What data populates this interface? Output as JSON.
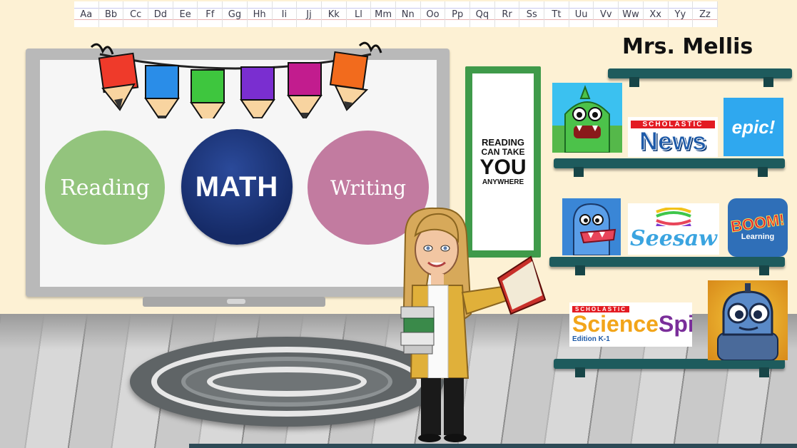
{
  "alphabet": [
    "Aa",
    "Bb",
    "Cc",
    "Dd",
    "Ee",
    "Ff",
    "Gg",
    "Hh",
    "Ii",
    "Jj",
    "Kk",
    "Ll",
    "Mm",
    "Nn",
    "Oo",
    "Pp",
    "Qq",
    "Rr",
    "Ss",
    "Tt",
    "Uu",
    "Vv",
    "Ww",
    "Xx",
    "Yy",
    "Zz"
  ],
  "teacher_name": "Mrs. Mellis",
  "subjects": {
    "reading": "Reading",
    "math": "MATH",
    "writing": "Writing"
  },
  "poster": {
    "line1": "READING",
    "line2": "CAN TAKE",
    "line3": "YOU",
    "line4": "ANYWHERE"
  },
  "apps": {
    "scholastic_news": {
      "tag": "SCHOLASTIC",
      "word": "News"
    },
    "epic": "epic!",
    "seesaw": "Seesaw",
    "boom": {
      "word": "BOOM!",
      "sub": "Learning"
    },
    "science_spin": {
      "tag": "SCHOLASTIC",
      "word_a": "Science",
      "word_b": "Spin",
      "edition": "Edition K-1"
    }
  },
  "colors": {
    "wall": "#fdf1d4",
    "reading": "#93c47d",
    "math": "#1a3373",
    "writing": "#c27ba0",
    "shelf": "#1e5b5d",
    "poster_leaf": "#3f9a4a"
  },
  "icons": [
    "pencil-bunting",
    "monster-app-icon",
    "dino-app-icon",
    "robot-app-icon",
    "teacher-avatar",
    "smartboard",
    "rug"
  ]
}
